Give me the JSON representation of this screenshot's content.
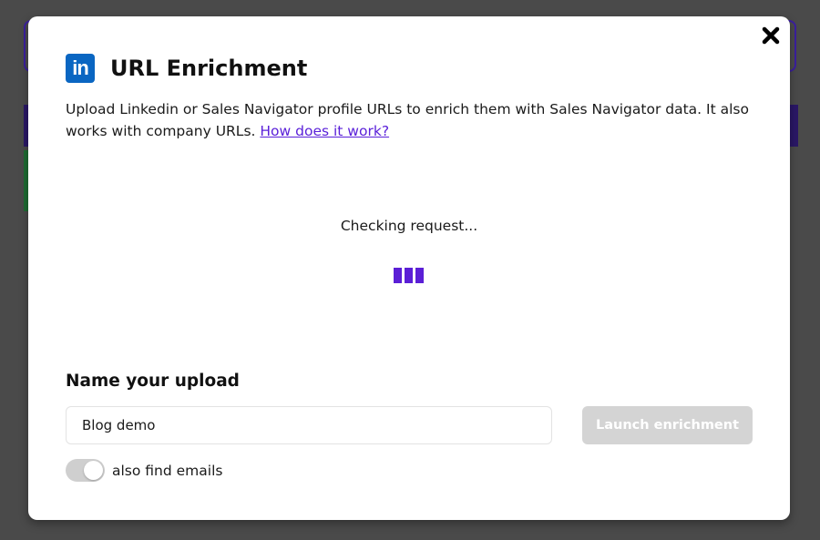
{
  "modal": {
    "title": "URL Enrichment",
    "description": "Upload Linkedin or Sales Navigator profile URLs to enrich them with Sales Navigator data. It also works with company URLs.",
    "help_link": "How does it work?",
    "logo_text": "in",
    "status": "Checking request...",
    "upload": {
      "label": "Name your upload",
      "input_value": "Blog demo",
      "launch_button": "Launch enrichment"
    },
    "email_toggle": {
      "label": "also find emails",
      "enabled": true
    }
  },
  "colors": {
    "accent": "#5b1fd6",
    "link": "#5b21d9",
    "linkedin_blue": "#0a66c2",
    "disabled_button": "#d4d4d4",
    "overlay": "#4a4a4a"
  },
  "icons": {
    "close": "close-icon",
    "logo": "linkedin-logo-icon",
    "loader": "loading-bars-icon"
  }
}
